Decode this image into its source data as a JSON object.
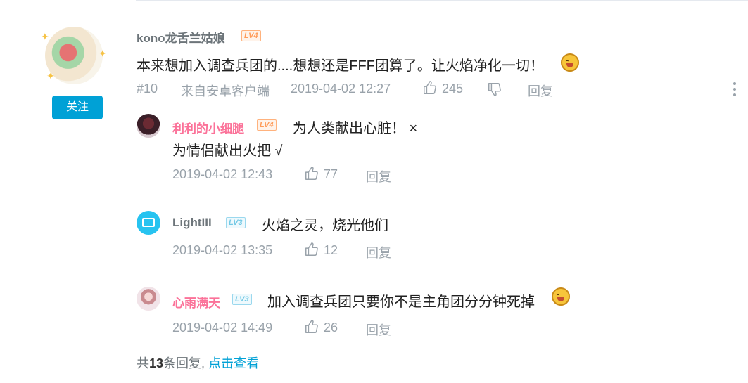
{
  "main_comment": {
    "username": "kono龙舌兰姑娘",
    "level": "LV4",
    "text": "本来想加入调查兵团的....想想还是FFF团算了。让火焰净化一切！",
    "floor": "#10",
    "source": "来自安卓客户端",
    "time": "2019-04-02 12:27",
    "likes": "245",
    "reply_label": "回复",
    "follow_label": "关注"
  },
  "replies": [
    {
      "username": "利利的小细腿",
      "level": "LV4",
      "text_line1": "为人类献出心脏！ ×",
      "text_line2": "为情侣献出火把 √",
      "time": "2019-04-02 12:43",
      "likes": "77",
      "reply_label": "回复"
    },
    {
      "username": "LightIII",
      "level": "LV3",
      "text_line1": "火焰之灵，烧光他们",
      "time": "2019-04-02 13:35",
      "likes": "12",
      "reply_label": "回复"
    },
    {
      "username": "心雨满天",
      "level": "LV3",
      "text_line1": "加入调查兵团只要你不是主角团分分钟死掉",
      "time": "2019-04-02 14:49",
      "likes": "26",
      "reply_label": "回复"
    }
  ],
  "footer": {
    "prefix": "共",
    "count": "13",
    "suffix": "条回复,",
    "view_link": "点击查看"
  },
  "colors": {
    "accent": "#00a1d6",
    "pink_name": "#fb7299",
    "meta_gray": "#99a2aa"
  }
}
